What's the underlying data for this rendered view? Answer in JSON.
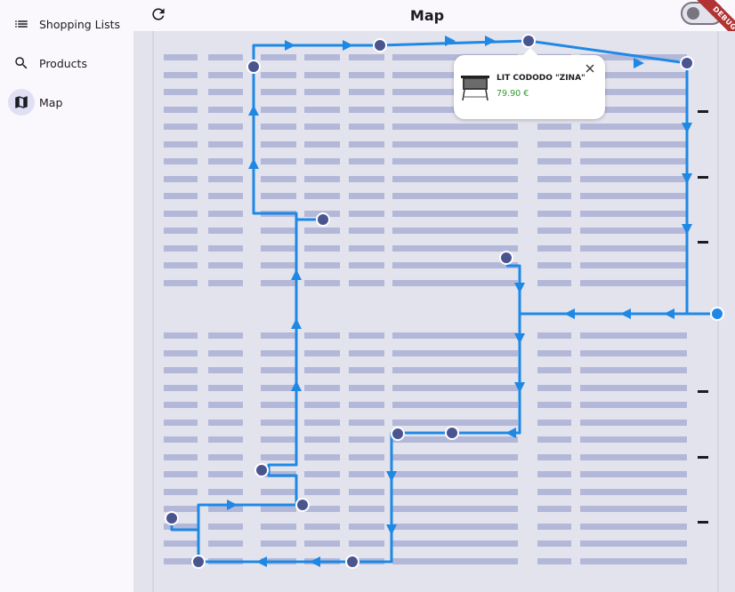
{
  "sidebar": {
    "items": [
      {
        "label": "Shopping Lists",
        "icon": "list-icon",
        "active": false
      },
      {
        "label": "Products",
        "icon": "search-icon",
        "active": false
      },
      {
        "label": "Map",
        "icon": "map-icon",
        "active": true
      }
    ]
  },
  "appbar": {
    "title": "Map",
    "refresh_icon": "refresh-icon",
    "toggle_on": false
  },
  "debug_banner": "DEBUG",
  "popup": {
    "product_name": "LIT CODODO \"ZINA\"",
    "price": "79.90 €",
    "image_icon": "crib-icon",
    "close_icon": "close-icon"
  },
  "colors": {
    "route": "#1e88e5",
    "stop": "#4a5590",
    "shelf": "#b3b8d9",
    "map_bg": "#e3e3ed",
    "price": "#2e9b2e"
  }
}
